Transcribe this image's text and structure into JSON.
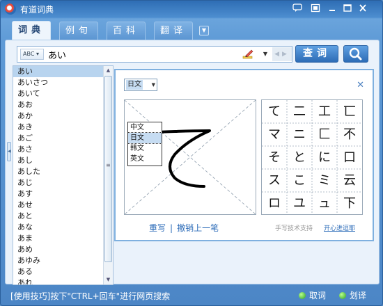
{
  "window": {
    "title": "有道词典",
    "buttons": [
      "comment-icon",
      "settings-icon",
      "minimize-icon",
      "restore-icon",
      "close-icon"
    ]
  },
  "tabs": [
    {
      "label": "词典",
      "active": true
    },
    {
      "label": "例句",
      "active": false
    },
    {
      "label": "百科",
      "active": false
    },
    {
      "label": "翻译",
      "active": false
    }
  ],
  "search": {
    "lang_selector": "ABC",
    "query": "あい",
    "lookup_label": "查词",
    "websearch_icon": "magnifier-icon"
  },
  "wordlist": {
    "items": [
      "あい",
      "あいさつ",
      "あいて",
      "あお",
      "あか",
      "あき",
      "あご",
      "あさ",
      "あし",
      "あした",
      "あじ",
      "あす",
      "あせ",
      "あと",
      "あな",
      "あま",
      "あめ",
      "あゆみ",
      "ある",
      "あれ"
    ],
    "selected_index": 0
  },
  "handwriting": {
    "lang_value": "日文",
    "lang_options": [
      "中文",
      "日文",
      "韩文",
      "英文"
    ],
    "selected_option_index": 1,
    "candidates": [
      "て",
      "二",
      "工",
      "匸",
      "マ",
      "ニ",
      "匚",
      "不",
      "そ",
      "と",
      "に",
      "口",
      "ス",
      "こ",
      "ミ",
      "云",
      "ロ",
      "ユ",
      "ュ",
      "下"
    ],
    "rewrite_label": "重写",
    "undo_label": "撤销上一笔",
    "credit_text": "手写技术支持",
    "credit_link": "开心进逗耶"
  },
  "status": {
    "tip": "[使用技巧]按下\"CTRL+回车\"进行网页搜索",
    "lookup_label": "取词",
    "translate_label": "划译"
  },
  "colors": {
    "accent": "#2b6bb8",
    "frame": "#4c86c6",
    "selection": "#b8d4ef"
  }
}
